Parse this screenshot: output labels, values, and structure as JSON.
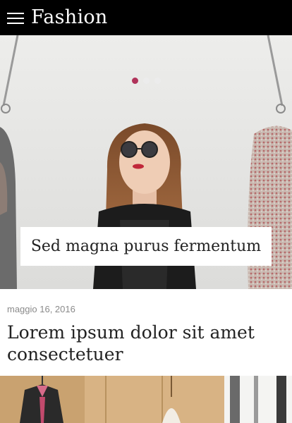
{
  "header": {
    "title": "Fashion"
  },
  "hero": {
    "caption": "Sed magna purus fermentum",
    "slides_total": 3,
    "active_slide": 1
  },
  "post": {
    "date": "maggio 16, 2016",
    "title": "Lorem ipsum dolor sit amet consectetuer"
  },
  "colors": {
    "header_bg": "#000000",
    "accent": "#b0335a"
  },
  "icons": {
    "menu": "hamburger-menu-icon"
  }
}
